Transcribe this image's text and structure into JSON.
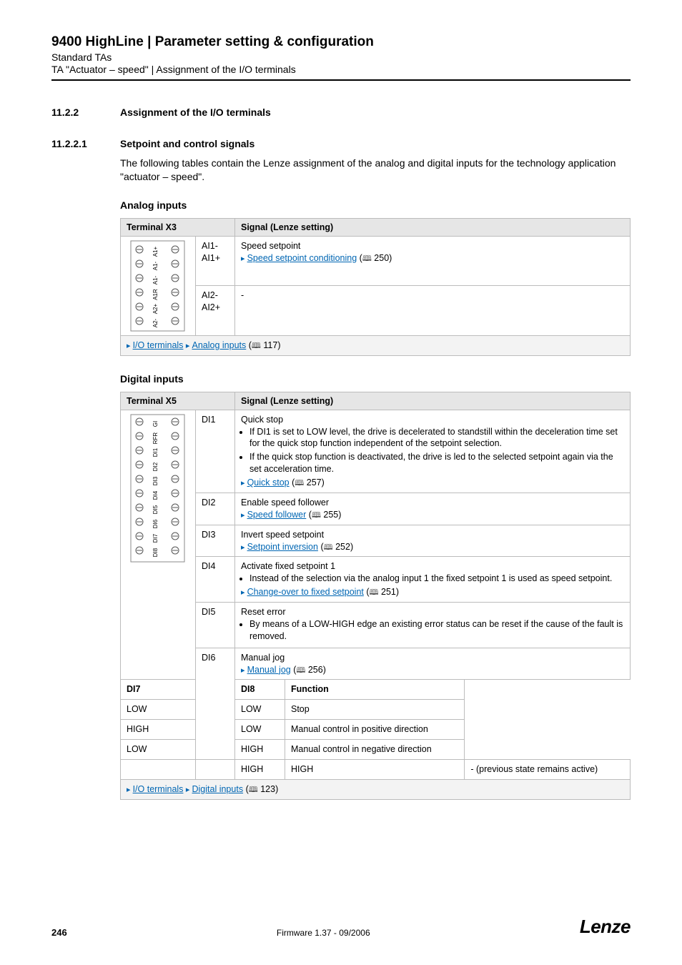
{
  "header": {
    "title": "9400 HighLine | Parameter setting & configuration",
    "sub1": "Standard TAs",
    "sub2": "TA \"Actuator – speed\" | Assignment of the I/O terminals"
  },
  "sections": {
    "s1": {
      "num": "11.2.2",
      "title": "Assignment of the I/O terminals"
    },
    "s2": {
      "num": "11.2.2.1",
      "title": "Setpoint and control signals"
    }
  },
  "intro": "The following tables contain the Lenze assignment of the analog and digital inputs for the technology application \"actuator – speed\".",
  "analog": {
    "heading": "Analog inputs",
    "col1": "Terminal X3",
    "col2": "Signal (Lenze setting)",
    "term_labels": [
      "A1+",
      "A1-",
      "A1-",
      "A1R",
      "A2+",
      "A2-"
    ],
    "rows": [
      {
        "label": "AI1-\nAI1+",
        "text": "Speed setpoint",
        "link": "Speed setpoint conditioning",
        "page": "250"
      },
      {
        "label": "AI2-\nAI2+",
        "text": "-",
        "link": "",
        "page": ""
      }
    ],
    "footer_links": {
      "a": "I/O terminals",
      "b": "Analog inputs",
      "page": "117"
    }
  },
  "digital": {
    "heading": "Digital inputs",
    "col1": "Terminal X5",
    "col2": "Signal (Lenze setting)",
    "term_labels": [
      "GI",
      "RFR",
      "DI1",
      "DI2",
      "DI3",
      "DI4",
      "DI5",
      "DI6",
      "DI7",
      "DI8"
    ],
    "rows": {
      "di1": {
        "label": "DI1",
        "title": "Quick stop",
        "bullets": [
          "If DI1 is set to LOW level, the drive is decelerated to standstill within the deceleration time set for the quick stop function independent of the setpoint selection.",
          "If the quick stop function is deactivated, the drive is led to the selected setpoint again via the set acceleration time."
        ],
        "link": "Quick stop",
        "page": "257"
      },
      "di2": {
        "label": "DI2",
        "title": "Enable speed follower",
        "link": "Speed follower",
        "page": "255"
      },
      "di3": {
        "label": "DI3",
        "title": "Invert speed setpoint",
        "link": "Setpoint inversion",
        "page": "252"
      },
      "di4": {
        "label": "DI4",
        "title": "Activate fixed setpoint 1",
        "bullets": [
          "Instead of the selection via the analog input 1 the fixed setpoint 1 is used as speed setpoint."
        ],
        "link": "Change-over to fixed setpoint",
        "page": "251"
      },
      "di5": {
        "label": "DI5",
        "title": "Reset error",
        "bullets": [
          "By means of a LOW-HIGH edge an existing error status can be reset if the cause of the fault is removed."
        ]
      },
      "di6": {
        "label": "DI6",
        "title": "Manual jog",
        "link": "Manual jog",
        "page": "256",
        "nested": {
          "headers": [
            "DI7",
            "DI8",
            "Function"
          ],
          "rows": [
            [
              "LOW",
              "LOW",
              "Stop"
            ],
            [
              "HIGH",
              "LOW",
              "Manual control in positive direction"
            ],
            [
              "LOW",
              "HIGH",
              "Manual control in negative direction"
            ],
            [
              "HIGH",
              "HIGH",
              "- (previous state remains active)"
            ]
          ]
        }
      }
    },
    "footer_links": {
      "a": "I/O terminals",
      "b": "Digital inputs",
      "page": "123"
    }
  },
  "footer": {
    "page": "246",
    "center": "Firmware 1.37 - 09/2006",
    "logo": "Lenze"
  }
}
